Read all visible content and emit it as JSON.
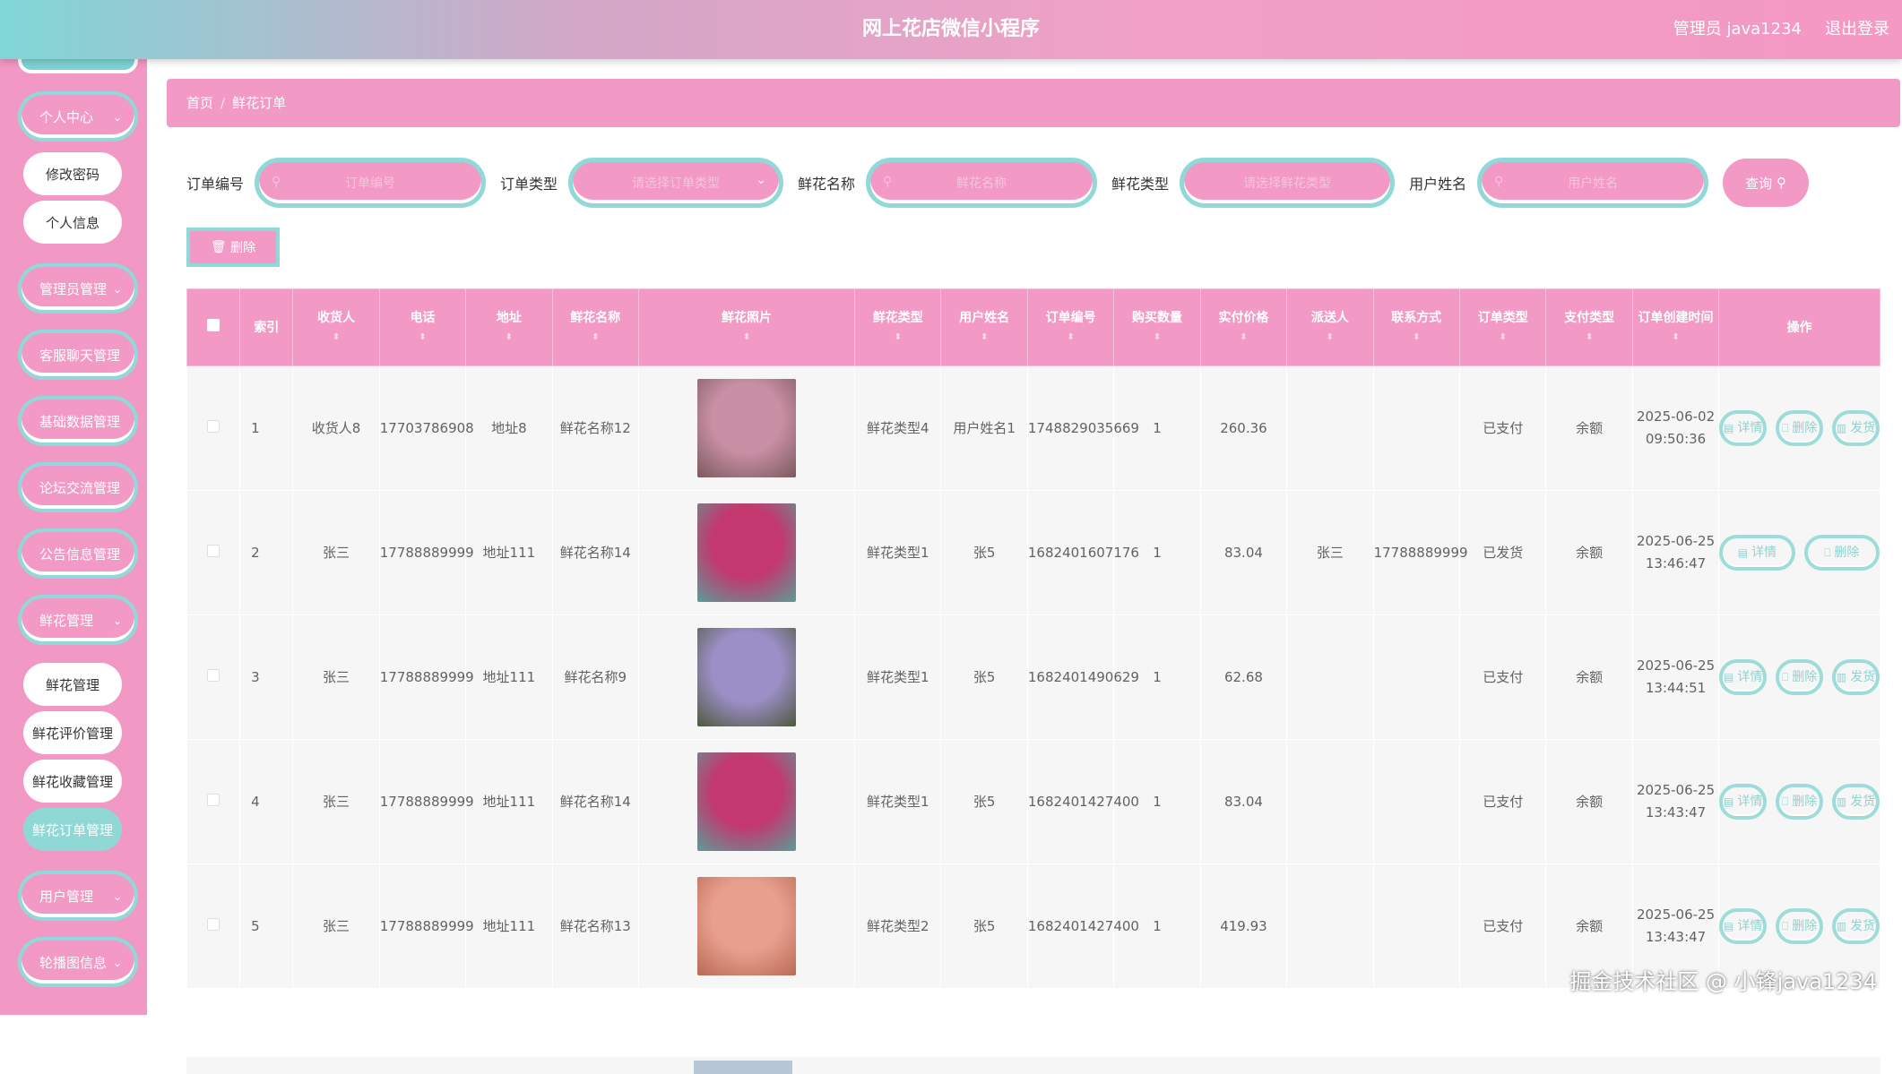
{
  "header": {
    "title": "网上花店微信小程序",
    "user": "管理员 java1234",
    "logout": "退出登录"
  },
  "sidebar": {
    "personal": "个人中心",
    "change_password": "修改密码",
    "personal_info": "个人信息",
    "admin_mgmt": "管理员管理",
    "chat_mgmt": "客服聊天管理",
    "base_data": "基础数据管理",
    "forum_mgmt": "论坛交流管理",
    "notice_mgmt": "公告信息管理",
    "flower_mgmt": "鲜花管理",
    "flower_sub": "鲜花管理",
    "review_mgmt": "鲜花评价管理",
    "collect_mgmt": "鲜花收藏管理",
    "order_mgmt": "鲜花订单管理",
    "user_mgmt": "用户管理",
    "carousel": "轮播图信息"
  },
  "breadcrumb": {
    "home": "首页",
    "sep": "/",
    "current": "鲜花订单"
  },
  "filters": {
    "order_no_label": "订单编号",
    "order_no_placeholder": "订单编号",
    "order_type_label": "订单类型",
    "order_type_placeholder": "请选择订单类型",
    "flower_name_label": "鲜花名称",
    "flower_name_placeholder": "鲜花名称",
    "flower_type_label": "鲜花类型",
    "flower_type_placeholder": "请选择鲜花类型",
    "user_name_label": "用户姓名",
    "user_name_placeholder": "用户姓名",
    "query": "查询"
  },
  "toolbar": {
    "delete": "删除"
  },
  "table": {
    "headers": [
      "索引",
      "收货人",
      "电话",
      "地址",
      "鲜花名称",
      "鲜花照片",
      "鲜花类型",
      "用户姓名",
      "订单编号",
      "购买数量",
      "实付价格",
      "派送人",
      "联系方式",
      "订单类型",
      "支付类型",
      "订单创建时间",
      "操作"
    ],
    "rows": [
      {
        "idx": "1",
        "receiver": "收货人8",
        "phone": "17703786908",
        "address": "地址8",
        "flower": "鲜花名称12",
        "type": "鲜花类型4",
        "user": "用户姓名1",
        "order_no": "1748829035669",
        "qty": "1",
        "price": "260.36",
        "courier": "",
        "contact": "",
        "order_type": "已支付",
        "pay_type": "余额",
        "created": "2025-06-02 09:50:36",
        "colors": [
          "#c98fa4",
          "#7a5a5e"
        ]
      },
      {
        "idx": "2",
        "receiver": "张三",
        "phone": "17788889999",
        "address": "地址111",
        "flower": "鲜花名称14",
        "type": "鲜花类型1",
        "user": "张5",
        "order_no": "1682401607176",
        "qty": "1",
        "price": "83.04",
        "courier": "张三",
        "contact": "17788889999",
        "order_type": "已发货",
        "pay_type": "余额",
        "created": "2025-06-25 13:46:47",
        "colors": [
          "#c2386f",
          "#5c9c96"
        ]
      },
      {
        "idx": "3",
        "receiver": "张三",
        "phone": "17788889999",
        "address": "地址111",
        "flower": "鲜花名称9",
        "type": "鲜花类型1",
        "user": "张5",
        "order_no": "1682401490629",
        "qty": "1",
        "price": "62.68",
        "courier": "",
        "contact": "",
        "order_type": "已支付",
        "pay_type": "余额",
        "created": "2025-06-25 13:44:51",
        "colors": [
          "#9c8fc8",
          "#4e5a3e"
        ]
      },
      {
        "idx": "4",
        "receiver": "张三",
        "phone": "17788889999",
        "address": "地址111",
        "flower": "鲜花名称14",
        "type": "鲜花类型1",
        "user": "张5",
        "order_no": "1682401427400",
        "qty": "1",
        "price": "83.04",
        "courier": "",
        "contact": "",
        "order_type": "已支付",
        "pay_type": "余额",
        "created": "2025-06-25 13:43:47",
        "colors": [
          "#c2386f",
          "#5c9c96"
        ]
      },
      {
        "idx": "5",
        "receiver": "张三",
        "phone": "17788889999",
        "address": "地址111",
        "flower": "鲜花名称13",
        "type": "鲜花类型2",
        "user": "张5",
        "order_no": "1682401427400",
        "qty": "1",
        "price": "419.93",
        "courier": "",
        "contact": "",
        "order_type": "已支付",
        "pay_type": "余额",
        "created": "2025-06-25 13:43:47",
        "colors": [
          "#e8a08e",
          "#b96a55"
        ]
      }
    ]
  },
  "actions": {
    "detail": "详情",
    "delete": "删除",
    "ship": "发货"
  },
  "watermark": "掘金技术社区 @ 小锋java1234"
}
